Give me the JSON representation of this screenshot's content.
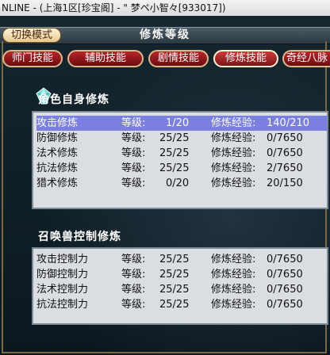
{
  "window": {
    "title": "NLINE - (上海1区[珍宝阁] - \" 梦ペ小智々[933017])"
  },
  "header": {
    "switch_label": "切换模式",
    "title": "修炼等级"
  },
  "tabs": [
    {
      "label": "师门技能"
    },
    {
      "label": "辅助技能"
    },
    {
      "label": "剧情技能"
    },
    {
      "label": "修炼技能",
      "active": true
    },
    {
      "label": "奇经八脉"
    }
  ],
  "self": {
    "title": "角色自身修炼",
    "rows": [
      {
        "name": "攻击修炼",
        "level_label": "等级:",
        "level": "1/20",
        "exp_label": "修炼经验:",
        "exp": "140/210",
        "selected": true
      },
      {
        "name": "防御修炼",
        "level_label": "等级:",
        "level": "25/25",
        "exp_label": "修炼经验:",
        "exp": "0/7650"
      },
      {
        "name": "法术修炼",
        "level_label": "等级:",
        "level": "25/25",
        "exp_label": "修炼经验:",
        "exp": "0/7650"
      },
      {
        "name": "抗法修炼",
        "level_label": "等级:",
        "level": "25/25",
        "exp_label": "修炼经验:",
        "exp": "2/7650"
      },
      {
        "name": "猎术修炼",
        "level_label": "等级:",
        "level": "0/20",
        "exp_label": "修炼经验:",
        "exp": "20/150"
      }
    ]
  },
  "pet": {
    "title": "召唤兽控制修炼",
    "rows": [
      {
        "name": "攻击控制力",
        "level_label": "等级:",
        "level": "25/25",
        "exp_label": "修炼经验:",
        "exp": "0/7650"
      },
      {
        "name": "防御控制力",
        "level_label": "等级:",
        "level": "25/25",
        "exp_label": "修炼经验:",
        "exp": "0/7650"
      },
      {
        "name": "法术控制力",
        "level_label": "等级:",
        "level": "25/25",
        "exp_label": "修炼经验:",
        "exp": "0/7650"
      },
      {
        "name": "抗法控制力",
        "level_label": "等级:",
        "level": "25/25",
        "exp_label": "修炼经验:",
        "exp": "0/7650"
      }
    ]
  },
  "colors": {
    "selection": "#7b7fe2",
    "tab_red": "#b8262a",
    "list_bg": "#dadde2"
  }
}
